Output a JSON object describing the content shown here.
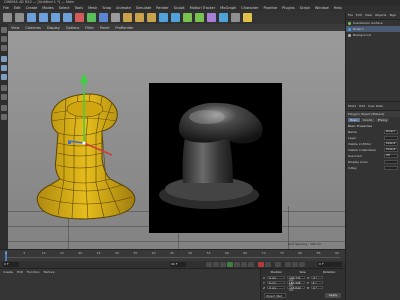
{
  "window": {
    "title": "CINEMA 4D R20 — [Untitled 1 *] — Main"
  },
  "menubar": {
    "items": [
      "File",
      "Edit",
      "Create",
      "Modes",
      "Select",
      "Tools",
      "Mesh",
      "Snap",
      "Animate",
      "Simulate",
      "Render",
      "Sculpt",
      "Motion Tracker",
      "MoGraph",
      "Character",
      "Pipeline",
      "Plugins",
      "Script",
      "Window",
      "Help"
    ]
  },
  "toolbar": {
    "buttons": [
      {
        "icon": "undo-icon",
        "color": "#8e8e8e"
      },
      {
        "icon": "redo-icon",
        "color": "#8e8e8e"
      },
      {
        "icon": "live-selection-icon",
        "color": "#6da0d8"
      },
      {
        "icon": "move-icon",
        "color": "#6da0d8"
      },
      {
        "icon": "scale-icon",
        "color": "#6da0d8"
      },
      {
        "icon": "rotate-icon",
        "color": "#6da0d8"
      },
      {
        "icon": "x-axis-icon",
        "color": "#d25c5c"
      },
      {
        "icon": "y-axis-icon",
        "color": "#5cbf5c"
      },
      {
        "icon": "z-axis-icon",
        "color": "#5c86d2"
      },
      {
        "icon": "coordinate-system-icon",
        "color": "#9a9a9a"
      },
      {
        "icon": "render-view-icon",
        "color": "#c9a24b"
      },
      {
        "icon": "render-picture-viewer-icon",
        "color": "#c9a24b"
      },
      {
        "icon": "render-settings-icon",
        "color": "#c9a24b"
      },
      {
        "icon": "cube-icon",
        "color": "#4fa3d8"
      },
      {
        "icon": "pen-icon",
        "color": "#4fa3d8"
      },
      {
        "icon": "subdivision-icon",
        "color": "#7ac24f"
      },
      {
        "icon": "array-icon",
        "color": "#7ac24f"
      },
      {
        "icon": "deformer-icon",
        "color": "#a97fd6"
      },
      {
        "icon": "floor-icon",
        "color": "#4fa3d8"
      },
      {
        "icon": "camera-icon",
        "color": "#8e8e8e"
      },
      {
        "icon": "light-icon",
        "color": "#e0c24a"
      }
    ]
  },
  "viewport": {
    "menu": [
      "View",
      "Cameras",
      "Display",
      "Options",
      "Filter",
      "Panel",
      "ProRender"
    ],
    "info": "Grid Spacing : 100 cm"
  },
  "object_manager": {
    "menu": [
      "File",
      "Edit",
      "View",
      "Objects",
      "Tags"
    ],
    "items": [
      {
        "name": "Subdivision Surface",
        "selected": false
      },
      {
        "name": "Bollard",
        "selected": true
      },
      {
        "name": "Background",
        "selected": false
      }
    ]
  },
  "attribute_manager": {
    "menu": [
      "Mode",
      "Edit",
      "User Data"
    ],
    "object_label": "Polygon Object [Bollard]",
    "tabs": [
      "Basic",
      "Coord.",
      "Phong"
    ],
    "section": "Basic Properties",
    "props": [
      {
        "label": "Name",
        "value": "Bollard"
      },
      {
        "label": "Layer",
        "value": ""
      },
      {
        "label": "Visible in Editor",
        "value": "Default"
      },
      {
        "label": "Visible in Renderer",
        "value": "Default"
      },
      {
        "label": "Use Color",
        "value": "Off"
      },
      {
        "label": "Display Color",
        "value": ""
      },
      {
        "label": "X-Ray",
        "value": ""
      }
    ]
  },
  "timeline": {
    "ticks": [
      "0",
      "5",
      "10",
      "15",
      "20",
      "25",
      "30",
      "35",
      "40",
      "45",
      "50",
      "55",
      "60",
      "65",
      "70",
      "75",
      "80",
      "85",
      "90"
    ],
    "current_frame": "0 F",
    "start_frame": "0 F",
    "end_frame": "90 F",
    "frame_readout": "0 F"
  },
  "material_manager": {
    "menu": [
      "Create",
      "Edit",
      "Function",
      "Texture"
    ]
  },
  "coordinates": {
    "headers": [
      "Position",
      "Size",
      "Rotation"
    ],
    "rows": [
      {
        "axis": "X",
        "pos": "0 cm",
        "size": "132.771 cm",
        "rot_label": "H",
        "rot": "0 °"
      },
      {
        "axis": "Y",
        "pos": "0 cm",
        "size": "186.328 cm",
        "rot_label": "P",
        "rot": "0 °"
      },
      {
        "axis": "Z",
        "pos": "0 cm",
        "size": "133.042 cm",
        "rot_label": "B",
        "rot": "0 °"
      }
    ],
    "mode": "Object (Rel)",
    "apply_label": "Apply"
  }
}
